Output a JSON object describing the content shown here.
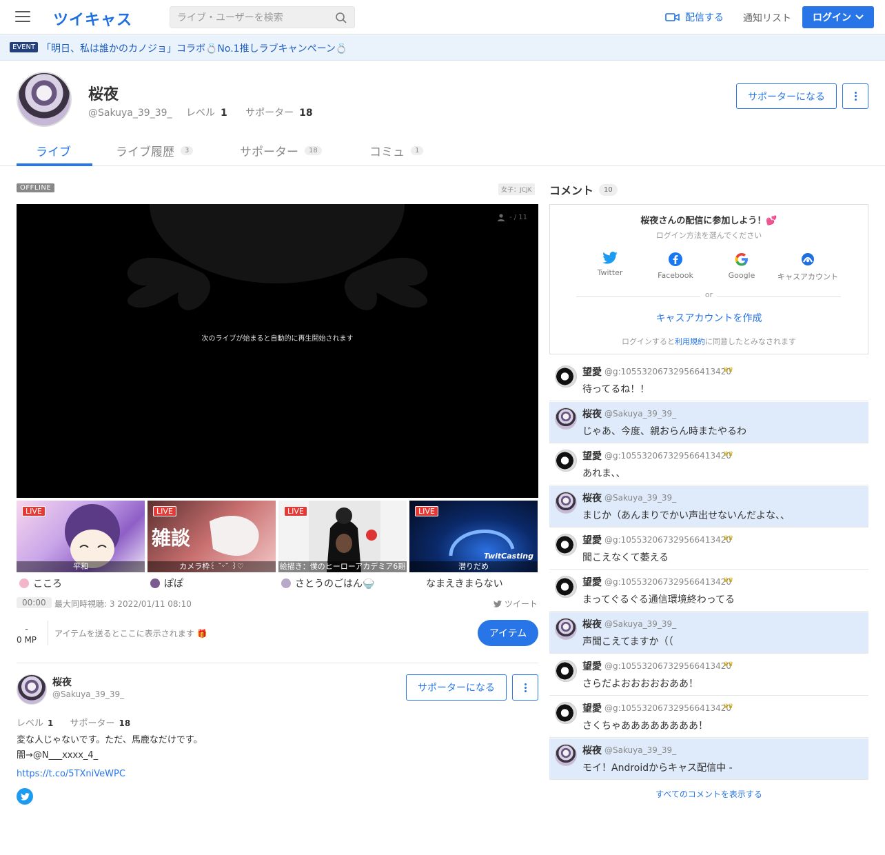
{
  "header": {
    "logo": "ツイキャス",
    "search_placeholder": "ライブ・ユーザーを検索",
    "broadcast_label": "配信する",
    "notify_label": "通知リスト",
    "login_label": "ログイン"
  },
  "event": {
    "badge": "EVENT",
    "text": "「明日、私は誰かのカノジョ」コラボ💍No.1推しラブキャンペーン💍"
  },
  "profile": {
    "name": "桜夜",
    "handle": "@Sakuya_39_39_",
    "level_label": "レベル",
    "level": "1",
    "supporter_label": "サポーター",
    "supporters": "18",
    "become_supporter": "サポーターになる"
  },
  "tabs": [
    {
      "label": "ライブ",
      "count": ""
    },
    {
      "label": "ライブ履歴",
      "count": "3"
    },
    {
      "label": "サポーター",
      "count": "18"
    },
    {
      "label": "コミュ",
      "count": "1"
    }
  ],
  "player": {
    "status": "OFFLINE",
    "category": "女子：JCJK",
    "viewers": "- / 11",
    "message": "次のライブが始まると自動的に再生開始されます"
  },
  "thumbs": [
    {
      "badge": "LIVE",
      "caption": "平和",
      "user": "こころ"
    },
    {
      "badge": "LIVE",
      "caption": "カメラ枠꒰ ˘ᵕ˘ ꒱♡",
      "user": "ぽぽ"
    },
    {
      "badge": "LIVE",
      "caption": "絵描き：僕のヒーローアカデミア6期",
      "user": "さとうのごはん🍚"
    },
    {
      "badge": "LIVE",
      "caption": "潜りだめ",
      "user": "なまえきまらない"
    }
  ],
  "stats": {
    "time": "00:00",
    "summary": "最大同時視聴: 3  2022/01/11 08:10",
    "tweet": "ツイート",
    "mp_dash": "-",
    "mp": "0 MP",
    "item_message": "アイテムを送るとここに表示されます 🎁",
    "item_button": "アイテム"
  },
  "bio": {
    "name": "桜夜",
    "handle": "@Sakuya_39_39_",
    "level_label": "レベル",
    "level": "1",
    "supporter_label": "サポーター",
    "supporters": "18",
    "line1": "変な人じゃないです。ただ、馬鹿なだけです。",
    "line2": "闇→@N___xxxx_4_",
    "link": "https://t.co/5TXniVeWPC",
    "become_supporter": "サポーターになる"
  },
  "comments_panel": {
    "title": "コメント",
    "count": "10",
    "login_title": "桜夜さんの配信に参加しよう！💕",
    "login_sub": "ログイン方法を選んでください",
    "sns": [
      "Twitter",
      "Facebook",
      "Google",
      "キャスアカウント"
    ],
    "or": "or",
    "create_account": "キャスアカウントを作成",
    "terms_pre": "ログインすると",
    "terms_link": "利用規約",
    "terms_post": "に同意したとみなされます",
    "show_all": "すべてのコメントを表示する"
  },
  "comments": [
    {
      "name": "望愛",
      "handle": "@g:105532067329566413420",
      "text": "待ってるね！！",
      "own": false
    },
    {
      "name": "桜夜",
      "handle": "@Sakuya_39_39_",
      "text": "じゃあ、今度、親おらん時またやるわ",
      "own": true
    },
    {
      "name": "望愛",
      "handle": "@g:105532067329566413420",
      "text": "あれま、、",
      "own": false
    },
    {
      "name": "桜夜",
      "handle": "@Sakuya_39_39_",
      "text": "まじか（あんまりでかい声出せないんだよな、、",
      "own": true
    },
    {
      "name": "望愛",
      "handle": "@g:105532067329566413420",
      "text": "聞こえなくて萎える",
      "own": false
    },
    {
      "name": "望愛",
      "handle": "@g:105532067329566413420",
      "text": "まってぐるぐる通信環境終わってる",
      "own": false
    },
    {
      "name": "桜夜",
      "handle": "@Sakuya_39_39_",
      "text": "声聞こえてますか（（",
      "own": true
    },
    {
      "name": "望愛",
      "handle": "@g:105532067329566413420",
      "text": "さらだよおおおおおああ！",
      "own": false
    },
    {
      "name": "望愛",
      "handle": "@g:105532067329566413420",
      "text": "さくちゃああああああああ！",
      "own": false
    },
    {
      "name": "桜夜",
      "handle": "@Sakuya_39_39_",
      "text": "モイ！Androidからキャス配信中 -",
      "own": true
    }
  ],
  "colors": {
    "accent": "#2775e6",
    "own_comment_bg": "#dfeafa",
    "live_red": "#e53935"
  }
}
